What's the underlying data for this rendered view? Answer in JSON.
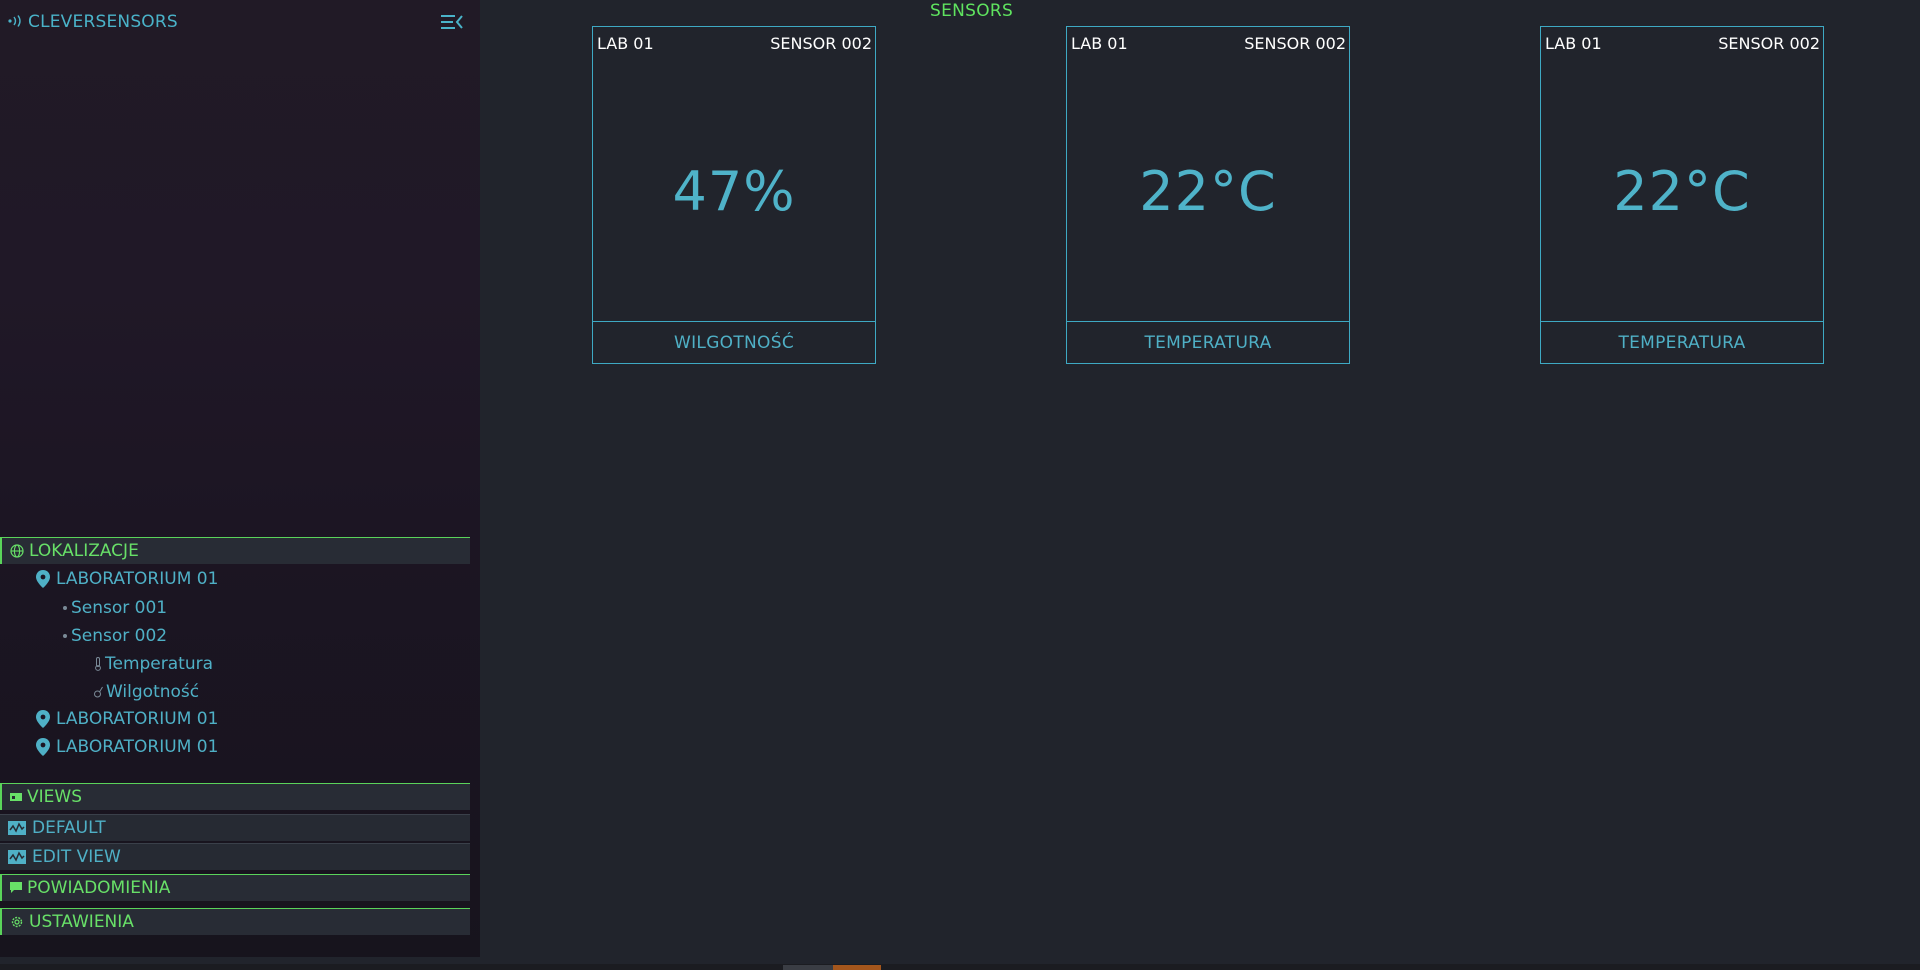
{
  "brand": {
    "name": "CLEVERSENSORS",
    "icon": "radio-waves-icon"
  },
  "main": {
    "title": "SENSORS"
  },
  "cards": [
    {
      "location": "LAB 01",
      "sensor": "SENSOR 002",
      "value": "47%",
      "label": "WILGOTNOŚĆ"
    },
    {
      "location": "LAB 01",
      "sensor": "SENSOR 002",
      "value": "22°C",
      "label": "TEMPERATURA"
    },
    {
      "location": "LAB 01",
      "sensor": "SENSOR 002",
      "value": "22°C",
      "label": "TEMPERATURA"
    }
  ],
  "sidebar": {
    "locations": {
      "header": "LOKALIZACJE",
      "lab1": "LABORATORIUM 01",
      "sensor1": "Sensor 001",
      "sensor2": "Sensor 002",
      "temperature": "Temperatura",
      "humidity": "Wilgotność",
      "lab2": "LABORATORIUM 01",
      "lab3": "LABORATORIUM 01"
    },
    "views": {
      "header": "VIEWS",
      "default": "DEFAULT",
      "edit": "EDIT VIEW"
    },
    "notifications": {
      "header": "POWIADOMIENIA"
    },
    "settings": {
      "header": "USTAWIENIA"
    }
  },
  "colors": {
    "accent_green": "#5ad35a",
    "accent_cyan": "#4fb0c6",
    "background": "#21242c"
  }
}
